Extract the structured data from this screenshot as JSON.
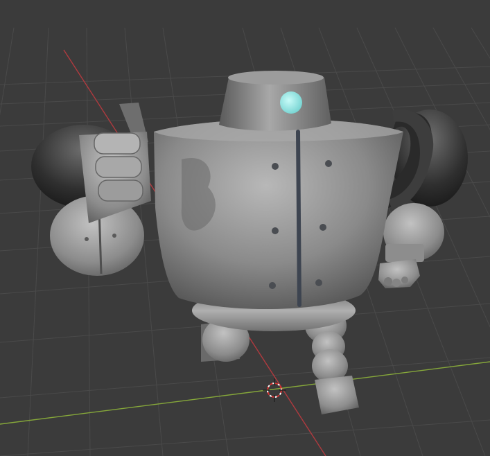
{
  "viewport": {
    "shading": "solid",
    "background_color": "#3b3b3b",
    "grid_color": "#4a4a4a",
    "axis_x_color": "#b03a3f",
    "axis_y_color": "#86a83a",
    "cursor_color": "#d83030"
  },
  "model": {
    "object": "robot",
    "body_color": "#8e8e8e",
    "eye_color": "#8ee0de",
    "icons": [
      "3d-cursor-icon"
    ]
  }
}
